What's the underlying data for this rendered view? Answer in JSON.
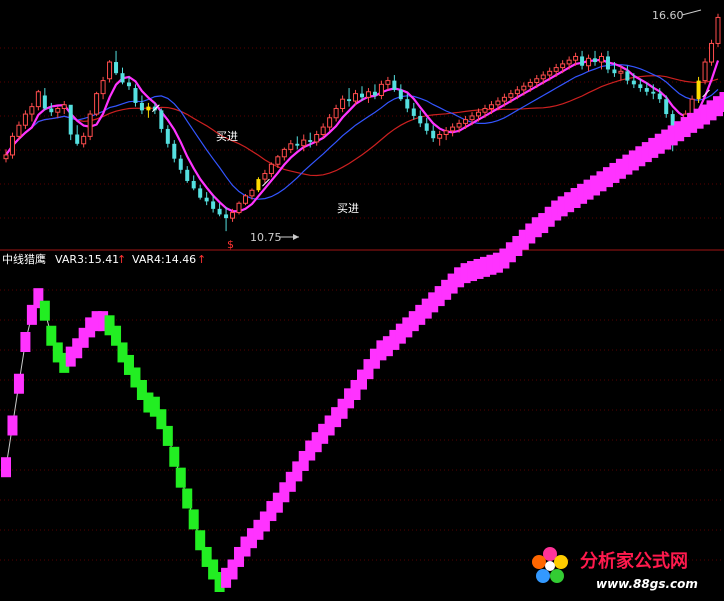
{
  "chart_data": {
    "type": "candlestick",
    "price_labels": {
      "high": "16.60",
      "low": "10.75"
    },
    "buy_signal_label": "买进",
    "buy_signal_indices": [
      22,
      39,
      107
    ],
    "marker_symbol": "$",
    "indicator_header": {
      "name": "中线猎鹰",
      "var3": "VAR3:15.41",
      "var4": "VAR4:14.46",
      "arrow": "↑"
    },
    "colors": {
      "up": "#ff4d4d",
      "down": "#55e0e0",
      "ma_fast": "#ff33ff",
      "ma_mid": "#3355ff",
      "ma_slow": "#cc2020",
      "signal": "#ffdd00",
      "rising": "#ff33ff",
      "falling": "#22ee22",
      "header_text": "#ffffff",
      "arrow": "#ff3333"
    },
    "candles": [
      [
        12.7,
        12.95,
        12.6,
        12.8
      ],
      [
        12.8,
        13.4,
        12.7,
        13.3
      ],
      [
        13.3,
        13.7,
        13.2,
        13.6
      ],
      [
        13.6,
        14.0,
        13.5,
        13.9
      ],
      [
        13.9,
        14.2,
        13.7,
        14.1
      ],
      [
        14.1,
        14.55,
        14.0,
        14.5
      ],
      [
        14.4,
        14.6,
        14.0,
        14.05
      ],
      [
        14.05,
        14.2,
        13.85,
        13.95
      ],
      [
        13.95,
        14.1,
        13.8,
        14.05
      ],
      [
        14.05,
        14.25,
        13.9,
        14.15
      ],
      [
        14.15,
        14.1,
        13.2,
        13.35
      ],
      [
        13.35,
        13.6,
        13.05,
        13.1
      ],
      [
        13.1,
        13.4,
        13.0,
        13.3
      ],
      [
        13.3,
        14.0,
        13.2,
        13.9
      ],
      [
        13.9,
        14.5,
        13.85,
        14.45
      ],
      [
        14.45,
        14.9,
        14.3,
        14.8
      ],
      [
        14.85,
        15.35,
        14.75,
        15.3
      ],
      [
        15.3,
        15.6,
        14.95,
        15.0
      ],
      [
        15.0,
        15.15,
        14.7,
        14.75
      ],
      [
        14.75,
        14.9,
        14.55,
        14.65
      ],
      [
        14.6,
        14.7,
        14.1,
        14.2
      ],
      [
        14.2,
        14.4,
        13.9,
        14.0
      ],
      [
        14.0,
        14.2,
        13.8,
        14.1
      ],
      [
        14.1,
        14.2,
        13.9,
        14.0
      ],
      [
        14.0,
        14.05,
        13.4,
        13.5
      ],
      [
        13.5,
        13.6,
        13.0,
        13.1
      ],
      [
        13.1,
        13.2,
        12.6,
        12.7
      ],
      [
        12.7,
        12.8,
        12.3,
        12.4
      ],
      [
        12.4,
        12.5,
        12.05,
        12.1
      ],
      [
        12.1,
        12.25,
        11.85,
        11.9
      ],
      [
        11.9,
        12.0,
        11.6,
        11.65
      ],
      [
        11.65,
        11.8,
        11.45,
        11.55
      ],
      [
        11.55,
        11.7,
        11.25,
        11.35
      ],
      [
        11.35,
        11.5,
        11.15,
        11.2
      ],
      [
        11.2,
        11.4,
        10.75,
        11.1
      ],
      [
        11.1,
        11.35,
        11.0,
        11.25
      ],
      [
        11.25,
        11.55,
        11.2,
        11.5
      ],
      [
        11.5,
        11.75,
        11.45,
        11.7
      ],
      [
        11.7,
        11.9,
        11.6,
        11.85
      ],
      [
        11.85,
        12.2,
        11.8,
        12.15
      ],
      [
        12.15,
        12.4,
        12.05,
        12.3
      ],
      [
        12.3,
        12.6,
        12.2,
        12.55
      ],
      [
        12.55,
        12.8,
        12.45,
        12.75
      ],
      [
        12.75,
        13.0,
        12.65,
        12.95
      ],
      [
        12.95,
        13.2,
        12.85,
        13.1
      ],
      [
        13.1,
        13.3,
        12.95,
        13.05
      ],
      [
        13.05,
        13.35,
        12.9,
        13.2
      ],
      [
        13.2,
        13.4,
        13.0,
        13.15
      ],
      [
        13.15,
        13.45,
        13.05,
        13.35
      ],
      [
        13.35,
        13.65,
        13.25,
        13.55
      ],
      [
        13.55,
        13.9,
        13.45,
        13.8
      ],
      [
        13.8,
        14.15,
        13.7,
        14.05
      ],
      [
        14.05,
        14.4,
        13.95,
        14.3
      ],
      [
        14.3,
        14.6,
        14.1,
        14.25
      ],
      [
        14.25,
        14.55,
        14.15,
        14.45
      ],
      [
        14.45,
        14.65,
        14.25,
        14.35
      ],
      [
        14.35,
        14.6,
        14.2,
        14.5
      ],
      [
        14.5,
        14.7,
        14.3,
        14.4
      ],
      [
        14.4,
        14.8,
        14.3,
        14.7
      ],
      [
        14.7,
        14.9,
        14.55,
        14.8
      ],
      [
        14.8,
        14.95,
        14.5,
        14.55
      ],
      [
        14.55,
        14.7,
        14.25,
        14.3
      ],
      [
        14.3,
        14.45,
        13.95,
        14.05
      ],
      [
        14.05,
        14.2,
        13.75,
        13.85
      ],
      [
        13.85,
        14.0,
        13.55,
        13.65
      ],
      [
        13.65,
        13.8,
        13.35,
        13.45
      ],
      [
        13.45,
        13.6,
        13.15,
        13.25
      ],
      [
        13.25,
        13.45,
        13.05,
        13.35
      ],
      [
        13.35,
        13.55,
        13.2,
        13.45
      ],
      [
        13.45,
        13.65,
        13.3,
        13.55
      ],
      [
        13.55,
        13.75,
        13.4,
        13.65
      ],
      [
        13.65,
        13.85,
        13.5,
        13.75
      ],
      [
        13.75,
        13.95,
        13.6,
        13.85
      ],
      [
        13.85,
        14.05,
        13.7,
        13.95
      ],
      [
        13.95,
        14.15,
        13.8,
        14.05
      ],
      [
        14.05,
        14.25,
        13.9,
        14.15
      ],
      [
        14.15,
        14.35,
        14.0,
        14.25
      ],
      [
        14.25,
        14.45,
        14.1,
        14.35
      ],
      [
        14.35,
        14.55,
        14.2,
        14.45
      ],
      [
        14.45,
        14.65,
        14.3,
        14.55
      ],
      [
        14.55,
        14.75,
        14.4,
        14.65
      ],
      [
        14.65,
        14.85,
        14.5,
        14.75
      ],
      [
        14.75,
        14.95,
        14.6,
        14.85
      ],
      [
        14.85,
        15.05,
        14.7,
        14.95
      ],
      [
        14.95,
        15.15,
        14.8,
        15.05
      ],
      [
        15.05,
        15.25,
        14.9,
        15.15
      ],
      [
        15.15,
        15.35,
        15.0,
        15.25
      ],
      [
        15.25,
        15.45,
        15.1,
        15.35
      ],
      [
        15.35,
        15.55,
        15.2,
        15.45
      ],
      [
        15.45,
        15.6,
        15.1,
        15.2
      ],
      [
        15.2,
        15.5,
        15.05,
        15.4
      ],
      [
        15.4,
        15.6,
        15.2,
        15.3
      ],
      [
        15.3,
        15.55,
        15.1,
        15.45
      ],
      [
        15.45,
        15.6,
        15.0,
        15.1
      ],
      [
        15.1,
        15.3,
        14.9,
        15.0
      ],
      [
        15.0,
        15.2,
        14.8,
        15.05
      ],
      [
        15.05,
        15.2,
        14.7,
        14.8
      ],
      [
        14.8,
        15.0,
        14.6,
        14.7
      ],
      [
        14.7,
        14.85,
        14.5,
        14.6
      ],
      [
        14.6,
        14.75,
        14.4,
        14.5
      ],
      [
        14.5,
        14.7,
        14.3,
        14.45
      ],
      [
        14.45,
        14.6,
        14.2,
        14.3
      ],
      [
        14.3,
        14.4,
        13.8,
        13.9
      ],
      [
        13.9,
        14.0,
        12.9,
        13.4
      ],
      [
        13.4,
        13.7,
        13.3,
        13.6
      ],
      [
        13.6,
        14.0,
        13.5,
        13.9
      ],
      [
        13.9,
        14.4,
        13.8,
        14.3
      ],
      [
        14.3,
        14.9,
        14.2,
        14.8
      ],
      [
        14.8,
        15.4,
        14.7,
        15.3
      ],
      [
        15.3,
        15.9,
        15.2,
        15.8
      ],
      [
        15.8,
        16.6,
        15.7,
        16.5
      ]
    ],
    "indicator": [
      14.55,
      14.75,
      14.95,
      15.15,
      15.28,
      15.36,
      15.3,
      15.18,
      15.1,
      15.05,
      15.08,
      15.12,
      15.17,
      15.22,
      15.25,
      15.25,
      15.23,
      15.18,
      15.1,
      15.04,
      14.98,
      14.92,
      14.86,
      14.84,
      14.78,
      14.7,
      14.6,
      14.5,
      14.4,
      14.3,
      14.2,
      14.12,
      14.06,
      14.0,
      14.02,
      14.06,
      14.12,
      14.17,
      14.21,
      14.25,
      14.29,
      14.34,
      14.38,
      14.43,
      14.48,
      14.53,
      14.58,
      14.63,
      14.67,
      14.71,
      14.75,
      14.79,
      14.83,
      14.88,
      14.92,
      14.97,
      15.02,
      15.07,
      15.11,
      15.13,
      15.16,
      15.19,
      15.22,
      15.25,
      15.28,
      15.31,
      15.34,
      15.37,
      15.4,
      15.43,
      15.46,
      15.48,
      15.49,
      15.5,
      15.51,
      15.52,
      15.53,
      15.55,
      15.58,
      15.61,
      15.64,
      15.67,
      15.7,
      15.72,
      15.75,
      15.78,
      15.8,
      15.82,
      15.84,
      15.86,
      15.88,
      15.9,
      15.92,
      15.94,
      15.96,
      15.98,
      16.0,
      16.02,
      16.04,
      16.06,
      16.08,
      16.1,
      16.12,
      16.14,
      16.16,
      16.18,
      16.2,
      16.22,
      16.24,
      16.26,
      16.28,
      16.3
    ]
  },
  "watermark": {
    "cn": "分析家公式网",
    "url": "www.88gs.com"
  }
}
